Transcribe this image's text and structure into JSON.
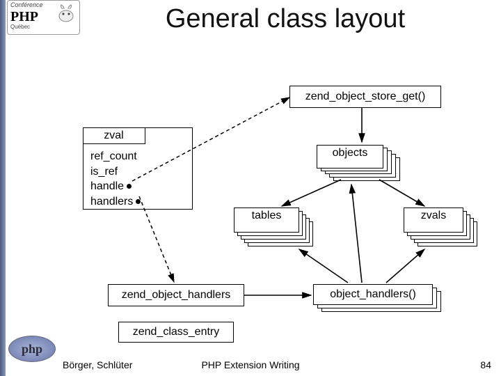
{
  "header": {
    "logo_line1": "Conférence",
    "logo_line2": "PHP",
    "logo_sub": "Québec"
  },
  "title": "General class layout",
  "boxes": {
    "zend_object_store_get": "zend_object_store_get()",
    "zval_title": "zval",
    "zval_fields": {
      "f1": "ref_count",
      "f2": "is_ref",
      "f3": "handle",
      "f4": "handlers"
    },
    "objects": "objects",
    "tables": "tables",
    "zvals": "zvals",
    "zend_object_handlers": "zend_object_handlers",
    "object_handlers_fn": "object_handlers()",
    "zend_class_entry": "zend_class_entry"
  },
  "footer": {
    "left": "Börger, Schlüter",
    "mid": "PHP Extension Writing",
    "page": "84"
  },
  "php_logo": "php"
}
